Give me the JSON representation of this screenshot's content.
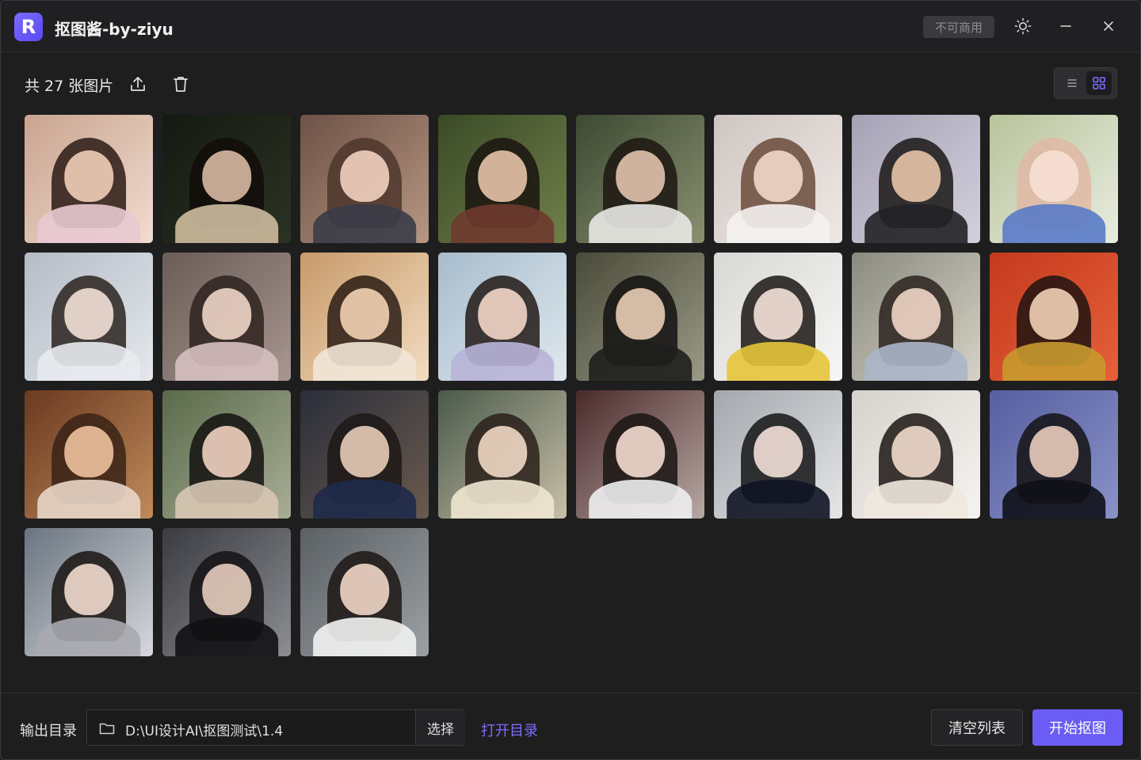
{
  "app": {
    "logo_letter": "R",
    "title": "抠图酱-by-ziyu",
    "license_badge": "不可商用"
  },
  "window_controls": {
    "theme_icon": "sun-icon",
    "minimize_icon": "minimize-icon",
    "close_icon": "close-icon"
  },
  "toolbar": {
    "count_label": "共 27 张图片",
    "upload_icon": "upload-icon",
    "delete_icon": "trash-icon",
    "view_modes": [
      "list-view-icon",
      "grid-view-icon"
    ],
    "active_view": "grid"
  },
  "images": [
    {
      "tone": [
        "#c9a48f",
        "#f1dccf"
      ],
      "hair": "#2a1a14",
      "skin": "#f0cdb8",
      "cloth": "#e8c9d2"
    },
    {
      "tone": [
        "#141a12",
        "#2c3222"
      ],
      "hair": "#120d0a",
      "skin": "#d8b9a2",
      "cloth": "#cdbc9e"
    },
    {
      "tone": [
        "#6d5246",
        "#b89682"
      ],
      "hair": "#4d362c",
      "skin": "#f2d2c0",
      "cloth": "#3a3c48"
    },
    {
      "tone": [
        "#3a4a26",
        "#70804a"
      ],
      "hair": "#1a1410",
      "skin": "#e6c2a6",
      "cloth": "#6e3a2c"
    },
    {
      "tone": [
        "#3c4a32",
        "#8a9070"
      ],
      "hair": "#1c1612",
      "skin": "#e2c3ad",
      "cloth": "#e8e8e4"
    },
    {
      "tone": [
        "#cfc6c2",
        "#eee8e4"
      ],
      "hair": "#6a4a38",
      "skin": "#f2d8c8",
      "cloth": "#f4f2f0"
    },
    {
      "tone": [
        "#a6a2b6",
        "#d2d0dc"
      ],
      "hair": "#1a1616",
      "skin": "#e8c4aa",
      "cloth": "#222226"
    },
    {
      "tone": [
        "#b8c49a",
        "#e8ece0"
      ],
      "hair": "#e0b8a4",
      "skin": "#f6e0d4",
      "cloth": "#5a7ac8"
    },
    {
      "tone": [
        "#b4bcc6",
        "#e4e8ec"
      ],
      "hair": "#2a2220",
      "skin": "#f2e0d6",
      "cloth": "#e8eaee"
    },
    {
      "tone": [
        "#6a5c56",
        "#a89690"
      ],
      "hair": "#2e2220",
      "skin": "#eed6c8",
      "cloth": "#d6c0c0"
    },
    {
      "tone": [
        "#c89a6a",
        "#f2dcc0"
      ],
      "hair": "#2a1c14",
      "skin": "#f2d2b4",
      "cloth": "#f2e6d6"
    },
    {
      "tone": [
        "#a8bccc",
        "#dee8ee"
      ],
      "hair": "#221a16",
      "skin": "#f2d6c6",
      "cloth": "#b8b4d8"
    },
    {
      "tone": [
        "#4a4a3a",
        "#9a9a86"
      ],
      "hair": "#141210",
      "skin": "#e8cdb6",
      "cloth": "#1e1e1c"
    },
    {
      "tone": [
        "#d8d8d6",
        "#f6f6f4"
      ],
      "hair": "#1a1614",
      "skin": "#f4e2d8",
      "cloth": "#e6c43a"
    },
    {
      "tone": [
        "#8a8a7e",
        "#d6d2c6"
      ],
      "hair": "#2a221e",
      "skin": "#f0d6c6",
      "cloth": "#aab6c8"
    },
    {
      "tone": [
        "#c43a1e",
        "#e6603a"
      ],
      "hair": "#1e1410",
      "skin": "#f2d0b6",
      "cloth": "#c89a2e"
    },
    {
      "tone": [
        "#6a3a20",
        "#c08a5a"
      ],
      "hair": "#3a2216",
      "skin": "#eec2a0",
      "cloth": "#e8d6c8"
    },
    {
      "tone": [
        "#5a6a4a",
        "#a8ae96"
      ],
      "hair": "#141210",
      "skin": "#f0d2c0",
      "cloth": "#d8c6b2"
    },
    {
      "tone": [
        "#2a2e3a",
        "#6a5a4e"
      ],
      "hair": "#1c1816",
      "skin": "#e8ccb8",
      "cloth": "#1e2a4a"
    },
    {
      "tone": [
        "#4a5a4a",
        "#c8c0a8"
      ],
      "hair": "#2a201a",
      "skin": "#f0d8c4",
      "cloth": "#f0e6d0"
    },
    {
      "tone": [
        "#4a2a2a",
        "#b8a8a4"
      ],
      "hair": "#1a1414",
      "skin": "#f4dcd0",
      "cloth": "#eeeef0"
    },
    {
      "tone": [
        "#a4a8ac",
        "#e4e6e8"
      ],
      "hair": "#141416",
      "skin": "#f2e0d8",
      "cloth": "#101424"
    },
    {
      "tone": [
        "#d6d2cc",
        "#f6f4f0"
      ],
      "hair": "#1c1614",
      "skin": "#f2dccc",
      "cloth": "#f0e8de"
    },
    {
      "tone": [
        "#5660a0",
        "#8a92c8"
      ],
      "hair": "#141214",
      "skin": "#e8ccbc",
      "cloth": "#101018"
    },
    {
      "tone": [
        "#6a7480",
        "#d6d8dc"
      ],
      "hair": "#1a1412",
      "skin": "#f2dace",
      "cloth": "#a8aab0"
    },
    {
      "tone": [
        "#3a3c42",
        "#8c8e94"
      ],
      "hair": "#141214",
      "skin": "#e6cdbe",
      "cloth": "#111114"
    },
    {
      "tone": [
        "#5a6064",
        "#9aa0a4"
      ],
      "hair": "#1c1614",
      "skin": "#f0d6c8",
      "cloth": "#f2f2f2"
    }
  ],
  "footer": {
    "output_label": "输出目录",
    "folder_icon": "folder-icon",
    "output_path": "D:\\UI设计AI\\抠图测试\\1.4",
    "choose_label": "选择",
    "open_dir_label": "打开目录",
    "clear_label": "清空列表",
    "start_label": "开始抠图"
  },
  "colors": {
    "accent": "#6b5cf6",
    "link": "#7b6cff",
    "background": "#1e1e1f"
  }
}
